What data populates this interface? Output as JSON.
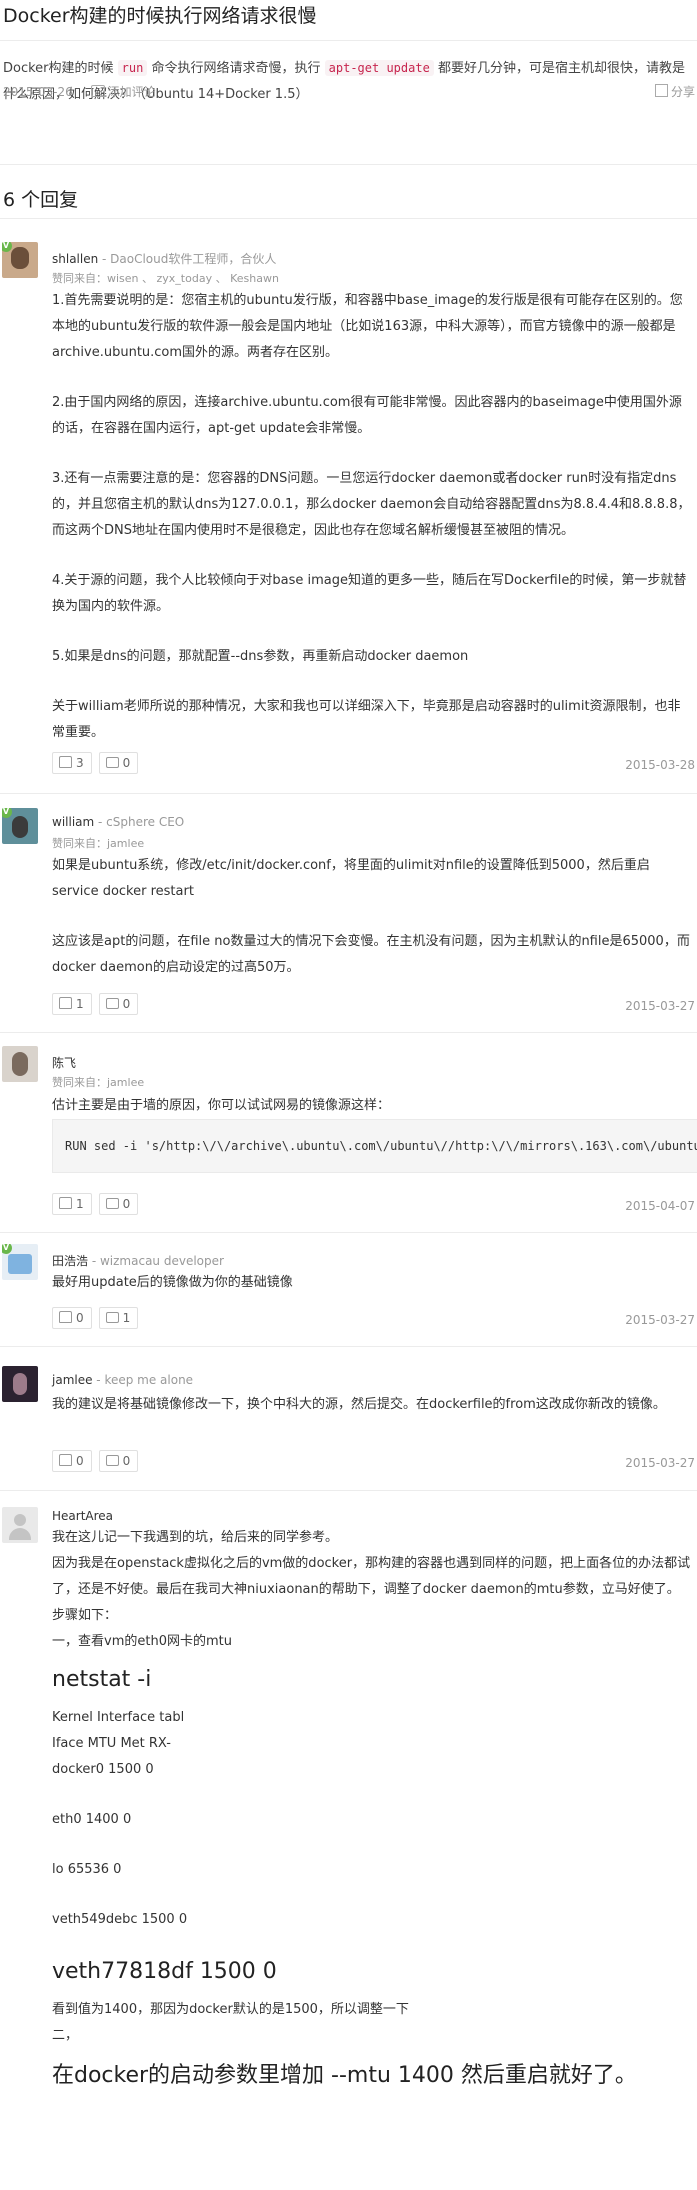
{
  "question": {
    "title": "Docker构建的时候执行网络请求很慢",
    "body_pre": "Docker构建的时候",
    "code1": "run",
    "body_mid": "命令执行网络请求奇慢，执行",
    "code2": "apt-get update",
    "body_post": "都要好几分钟，可是宿主机却很快，请教是什么原因，如何解决？（Ubuntu 14+Docker 1.5）",
    "date": "2015-03-26",
    "add_comment": "添加评论",
    "share": "分享"
  },
  "answers_header": "6 个回复",
  "labels": {
    "voters_prefix": "赞同来自："
  },
  "answers": [
    {
      "author": "shlallen",
      "bio": " - DaoCloud软件工程师，合伙人",
      "voters": "wisen 、 zyx_today 、 Keshawn",
      "paragraphs": [
        "1.首先需要说明的是：您宿主机的ubuntu发行版，和容器中base_image的发行版是很有可能存在区别的。您本地的ubuntu发行版的软件源一般会是国内地址（比如说163源，中科大源等），而官方镜像中的源一般都是archive.ubuntu.com国外的源。两者存在区别。",
        "2.由于国内网络的原因，连接archive.ubuntu.com很有可能非常慢。因此容器内的baseimage中使用国外源的话，在容器在国内运行，apt-get update会非常慢。",
        "3.还有一点需要注意的是：您容器的DNS问题。一旦您运行docker daemon或者docker run时没有指定dns的，并且您宿主机的默认dns为127.0.0.1，那么docker daemon会自动给容器配置dns为8.8.4.4和8.8.8.8，而这两个DNS地址在国内使用时不是很稳定，因此也存在您域名解析缓慢甚至被阻的情况。",
        "4.关于源的问题，我个人比较倾向于对base image知道的更多一些，随后在写Dockerfile的时候，第一步就替换为国内的软件源。",
        "5.如果是dns的问题，那就配置--dns参数，再重新启动docker daemon",
        "关于william老师所说的那种情况，大家和我也可以详细深入下，毕竟那是启动容器时的ulimit资源限制，也非常重要。"
      ],
      "likes": "3",
      "comments": "0",
      "date": "2015-03-28"
    },
    {
      "author": "william",
      "bio": " - cSphere CEO",
      "voters": "jamlee",
      "paragraphs": [
        "如果是ubuntu系统，修改/etc/init/docker.conf，将里面的ulimit对nfile的设置降低到5000，然后重启service docker restart",
        "这应该是apt的问题，在file no数量过大的情况下会变慢。在主机没有问题，因为主机默认的nfile是65000，而docker daemon的启动设定的过高50万。"
      ],
      "likes": "1",
      "comments": "0",
      "date": "2015-03-27"
    },
    {
      "author": "陈飞",
      "bio": "",
      "voters": "jamlee",
      "text": "估计主要是由于墙的原因，你可以试试网易的镜像源这样：",
      "code": "RUN sed -i 's/http:\\/\\/archive\\.ubuntu\\.com\\/ubuntu\\//http:\\/\\/mirrors\\.163\\.com\\/ubuntu\\//g' /etc/apt/sources.list",
      "likes": "1",
      "comments": "0",
      "date": "2015-04-07"
    },
    {
      "author": "田浩浩",
      "bio": " - wizmacau developer",
      "text": "最好用update后的镜像做为你的基础镜像",
      "likes": "0",
      "comments": "1",
      "date": "2015-03-27"
    },
    {
      "author": "jamlee",
      "bio": " - keep me alone",
      "text": "我的建议是将基础镜像修改一下，换个中科大的源，然后提交。在dockerfile的from这改成你新改的镜像。",
      "likes": "0",
      "comments": "0",
      "date": "2015-03-27"
    },
    {
      "author": "HeartArea",
      "bio": "",
      "lines": [
        "我在这儿记一下我遇到的坑，给后来的同学参考。",
        "因为我是在openstack虚拟化之后的vm做的docker，那构建的容器也遇到同样的问题，把上面各位的办法都试了，还是不好使。最后在我司大神niuxiaonan的帮助下，调整了docker daemon的mtu参数，立马好使了。",
        "步骤如下：",
        "一，查看vm的eth0网卡的mtu"
      ],
      "heading1": "netstat -i",
      "table_lines": [
        "Kernel Interface tabl",
        "Iface MTU Met RX-",
        "docker0 1500 0",
        "",
        "eth0 1400 0",
        "",
        "lo 65536 0",
        "",
        "veth549debc 1500 0"
      ],
      "heading2": "veth77818df 1500 0",
      "after_lines": [
        "看到值为1400，那因为docker默认的是1500，所以调整一下",
        "二，"
      ],
      "heading3": "在docker的启动参数里增加 --mtu 1400 然后重启就好了。"
    }
  ]
}
